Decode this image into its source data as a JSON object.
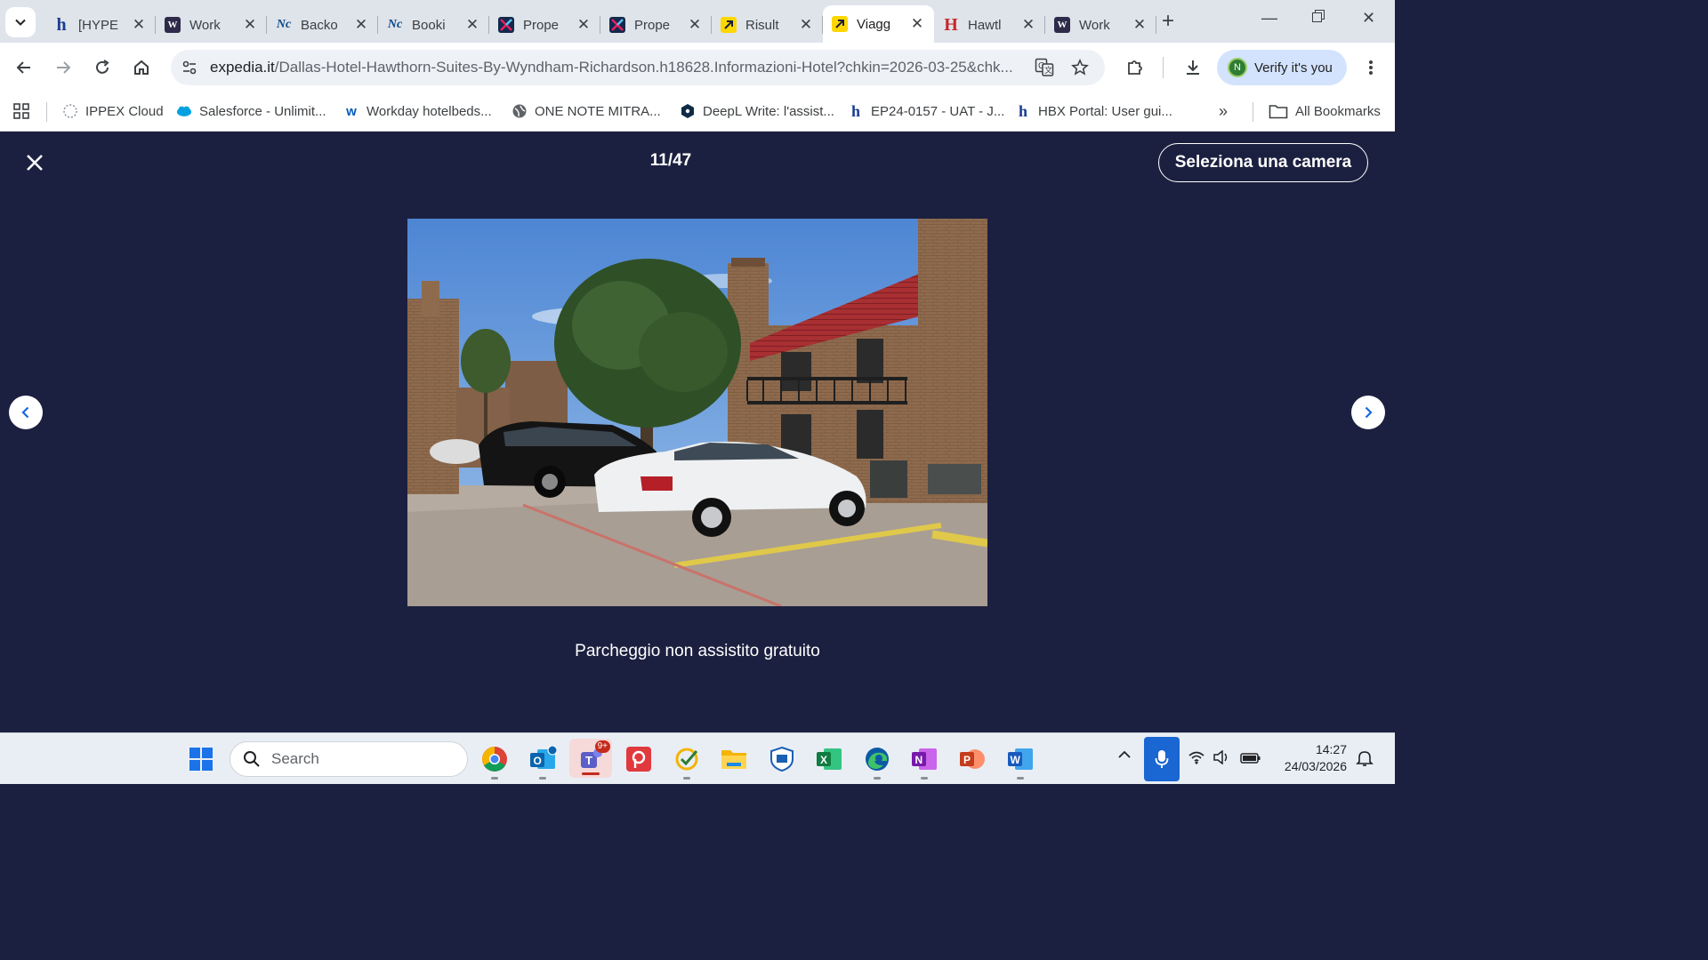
{
  "tabs": [
    {
      "title": "[HYPE",
      "favicon": "hotelbeds-h",
      "color": "#1a3d8f"
    },
    {
      "title": "Work",
      "favicon": "workday-w",
      "color": "#2d2a4a"
    },
    {
      "title": "Backo",
      "favicon": "nc-logo",
      "color": "#0c4a8a"
    },
    {
      "title": "Booki",
      "favicon": "nc-logo",
      "color": "#0c4a8a"
    },
    {
      "title": "Prope",
      "favicon": "x-logo",
      "color": "#13294b"
    },
    {
      "title": "Prope",
      "favicon": "x-logo",
      "color": "#13294b"
    },
    {
      "title": "Risult",
      "favicon": "arrow-logo",
      "color": "#ffd700"
    },
    {
      "title": "Viagg",
      "favicon": "arrow-logo",
      "color": "#ffd700",
      "active": true
    },
    {
      "title": "Hawtl",
      "favicon": "hawthorn-h",
      "color": "#c62828"
    },
    {
      "title": "Work",
      "favicon": "workday-w",
      "color": "#2d2a4a"
    }
  ],
  "address_bar": {
    "host": "expedia.it",
    "path": "/Dallas-Hotel-Hawthorn-Suites-By-Wyndham-Richardson.h18628.Informazioni-Hotel?chkin=2026-03-25&chk..."
  },
  "profile": {
    "initial": "N",
    "label": "Verify it's you"
  },
  "bookmarks": [
    {
      "label": "IPPEX Cloud",
      "icon": "cloud-icon"
    },
    {
      "label": "Salesforce - Unlimit...",
      "icon": "salesforce-icon"
    },
    {
      "label": "Workday hotelbeds...",
      "icon": "workday-icon"
    },
    {
      "label": "ONE NOTE MITRA...",
      "icon": "globe-icon"
    },
    {
      "label": "DeepL Write: l'assist...",
      "icon": "deepl-icon"
    },
    {
      "label": "EP24-0157 - UAT - J...",
      "icon": "hotelbeds-icon"
    },
    {
      "label": "HBX Portal: User gui...",
      "icon": "hotelbeds-icon"
    }
  ],
  "all_bookmarks_label": "All Bookmarks",
  "gallery": {
    "counter": "11/47",
    "select_room_label": "Seleziona una camera",
    "caption": "Parcheggio non assistito gratuito"
  },
  "taskbar": {
    "search_placeholder": "Search",
    "teams_badge": "9+",
    "time": "14:27",
    "date": "24/03/2026"
  },
  "colors": {
    "gallery_bg": "#1c2040",
    "accent_blue": "#1668e3",
    "tab_strip": "#dfe3ea"
  }
}
